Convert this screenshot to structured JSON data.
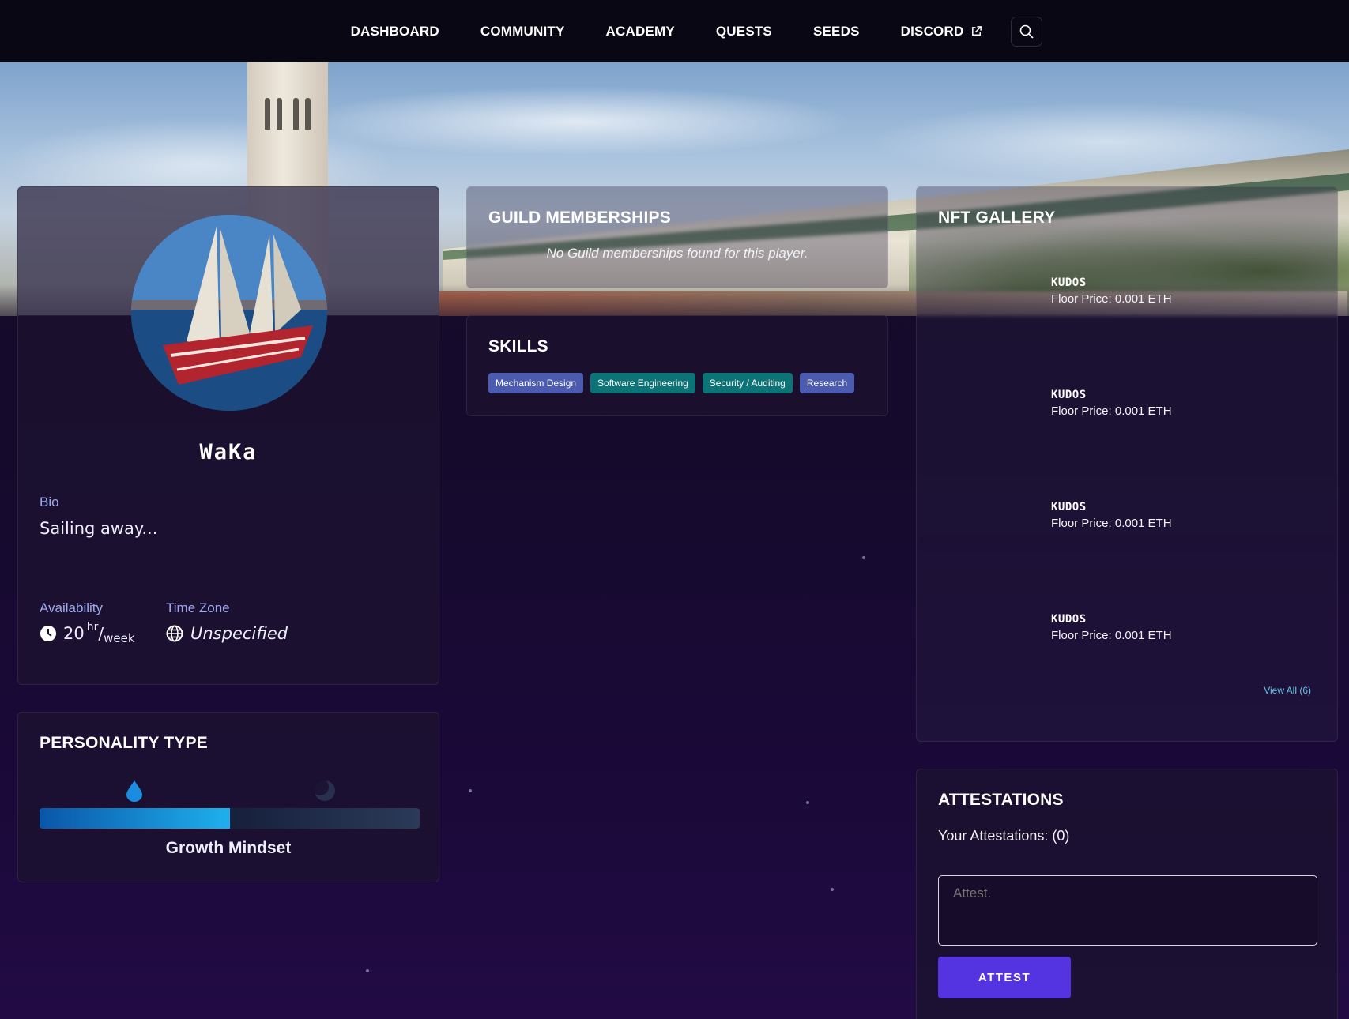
{
  "nav": {
    "items": [
      "DASHBOARD",
      "COMMUNITY",
      "ACADEMY",
      "QUESTS",
      "SEEDS",
      "DISCORD"
    ]
  },
  "profile": {
    "name": "WaKa",
    "bio_label": "Bio",
    "bio": "Sailing away...",
    "availability_label": "Availability",
    "availability_value": "20",
    "availability_sup": "hr",
    "availability_sub": "week",
    "timezone_label": "Time Zone",
    "timezone_value": "Unspecified"
  },
  "personality": {
    "title": "PERSONALITY TYPE",
    "label": "Growth Mindset",
    "fill_fraction": 0.5
  },
  "guild": {
    "title": "GUILD MEMBERSHIPS",
    "empty_text": "No Guild memberships found for this player."
  },
  "skills": {
    "title": "SKILLS",
    "tags": [
      {
        "label": "Mechanism Design",
        "color": "#4a5bb0"
      },
      {
        "label": "Software Engineering",
        "color": "#0c7377"
      },
      {
        "label": "Security / Auditing",
        "color": "#0c7377"
      },
      {
        "label": "Research",
        "color": "#4a5bb0"
      }
    ]
  },
  "nft": {
    "title": "NFT GALLERY",
    "items": [
      {
        "name": "KUDOS",
        "price": "Floor Price: 0.001 ETH"
      },
      {
        "name": "KUDOS",
        "price": "Floor Price: 0.001 ETH"
      },
      {
        "name": "KUDOS",
        "price": "Floor Price: 0.001 ETH"
      },
      {
        "name": "KUDOS",
        "price": "Floor Price: 0.001 ETH"
      }
    ],
    "view_all": "View All (6)"
  },
  "attestations": {
    "title": "ATTESTATIONS",
    "count_text": "Your Attestations: (0)",
    "placeholder": "Attest.",
    "button": "ATTEST"
  },
  "colors": {
    "accent_button": "#5434e0",
    "link": "#63c3e8"
  }
}
